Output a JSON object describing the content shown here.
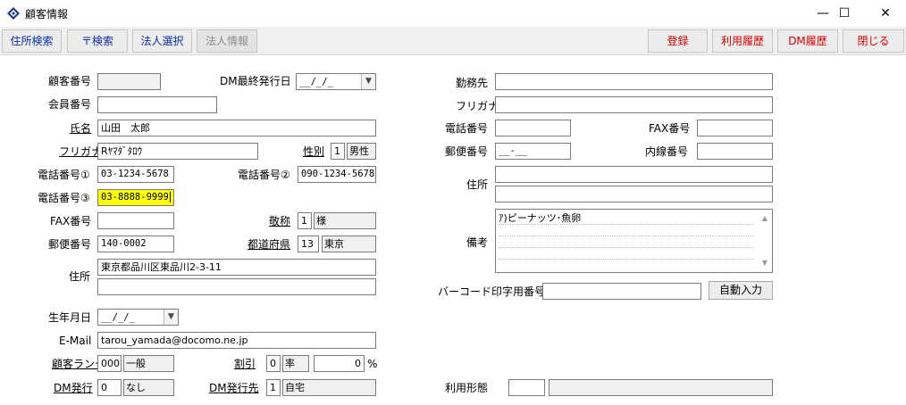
{
  "window": {
    "title": "顧客情報",
    "minimize": "—",
    "maximize": "☐",
    "close": "✕"
  },
  "toolbar": {
    "address_search": "住所検索",
    "zip_search": "〒検索",
    "corp_select": "法人選択",
    "corp_info": "法人情報",
    "register": "登録",
    "usage_history": "利用履歴",
    "dm_history": "DM履歴",
    "close": "閉じる"
  },
  "form": {
    "customer_no": {
      "label": "顧客番号",
      "value": ""
    },
    "dm_last_issue": {
      "label": "DM最終発行日",
      "value": "__/_/_"
    },
    "member_no": {
      "label": "会員番号",
      "value": ""
    },
    "name": {
      "label": "氏名",
      "value": "山田　太郎"
    },
    "furigana": {
      "label": "フリガナ",
      "value": "Rﾔﾏﾀﾞﾀﾛｳ"
    },
    "gender": {
      "label": "性別",
      "code": "1",
      "text": "男性"
    },
    "phone1": {
      "label": "電話番号①",
      "value": "03-1234-5678"
    },
    "phone2": {
      "label": "電話番号②",
      "value": "090-1234-5678"
    },
    "phone3": {
      "label": "電話番号③",
      "value": "03-8888-9999"
    },
    "fax": {
      "label": "FAX番号",
      "value": ""
    },
    "honorific": {
      "label": "敬称",
      "code": "1",
      "text": "様"
    },
    "zip": {
      "label": "郵便番号",
      "value": "140-0002"
    },
    "prefecture": {
      "label": "都道府県",
      "code": "13",
      "text": "東京"
    },
    "address": {
      "label": "住所",
      "line1": "東京都品川区東品川2-3-11",
      "line2": ""
    },
    "birthday": {
      "label": "生年月日",
      "value": "__/_/_"
    },
    "email": {
      "label": "E-Mail",
      "value": "tarou_yamada@docomo.ne.jp"
    },
    "rank": {
      "label": "顧客ランク",
      "code": "000",
      "text": "一般"
    },
    "discount": {
      "label": "割引",
      "code": "0",
      "text": "率",
      "value": "0",
      "unit": "%"
    },
    "dm_issue": {
      "label": "DM発行",
      "code": "0",
      "text": "なし"
    },
    "dm_dest": {
      "label": "DM発行先",
      "code": "1",
      "text": "自宅"
    },
    "company": {
      "label": "勤務先",
      "value": ""
    },
    "company_kana": {
      "label": "フリガナ",
      "value": ""
    },
    "company_phone": {
      "label": "電話番号",
      "value": ""
    },
    "company_fax": {
      "label": "FAX番号",
      "value": ""
    },
    "company_zip": {
      "label": "郵便番号",
      "value": "__-__"
    },
    "extension": {
      "label": "内線番号",
      "value": ""
    },
    "company_address": {
      "label": "住所",
      "line1": "",
      "line2": ""
    },
    "notes": {
      "label": "備考",
      "value": "ｱ)ピーナッツ･魚卵"
    },
    "barcode": {
      "label": "バーコード印字用番号",
      "value": "",
      "auto_button": "自動入力"
    },
    "usage_type": {
      "label": "利用形態",
      "code": "",
      "text": ""
    }
  },
  "colors": {
    "toolbar_blue": "#0b2fa8",
    "toolbar_red": "#d80000",
    "highlight": "#ffff00"
  }
}
